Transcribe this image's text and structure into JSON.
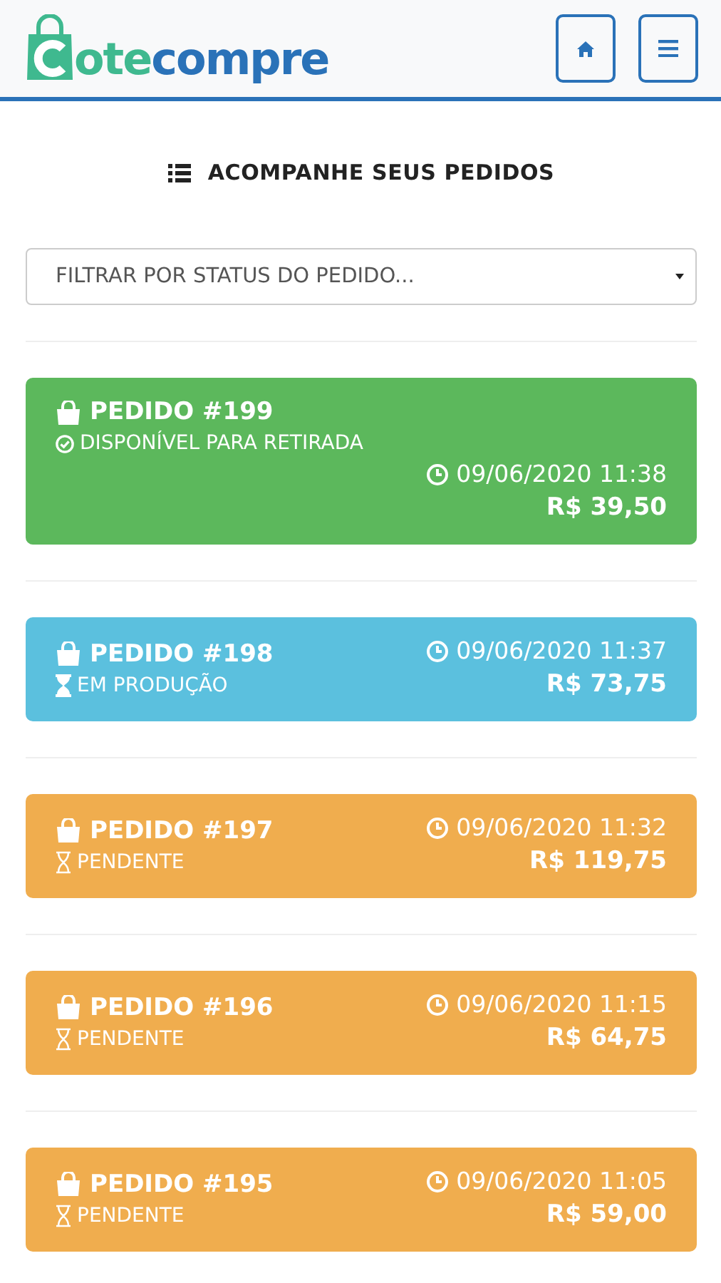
{
  "header": {
    "logo": {
      "part_1": "ote",
      "part_2": "compre"
    },
    "buttons": [
      {
        "kind": "home"
      },
      {
        "kind": "menu"
      }
    ]
  },
  "title": "ACOMPANHE SEUS PEDIDOS",
  "filter": {
    "placeholder": "FILTRAR POR STATUS DO PEDIDO..."
  },
  "orders": [
    {
      "kind": "ready",
      "title": "PEDIDO #199",
      "status": "DISPONÍVEL PARA RETIRADA",
      "date": "09/06/2020 11:38",
      "price": "R$ 39,50",
      "color": "#5cb85c"
    },
    {
      "kind": "production",
      "title": "PEDIDO #198",
      "status": "EM PRODUÇÃO",
      "date": "09/06/2020 11:37",
      "price": "R$ 73,75",
      "color": "#5bc0de"
    },
    {
      "kind": "pending",
      "title": "PEDIDO #197",
      "status": "PENDENTE",
      "date": "09/06/2020 11:32",
      "price": "R$ 119,75",
      "color": "#f0ad4e"
    },
    {
      "kind": "pending",
      "title": "PEDIDO #196",
      "status": "PENDENTE",
      "date": "09/06/2020 11:15",
      "price": "R$ 64,75",
      "color": "#f0ad4e"
    },
    {
      "kind": "pending",
      "title": "PEDIDO #195",
      "status": "PENDENTE",
      "date": "09/06/2020 11:05",
      "price": "R$ 59,00",
      "color": "#f0ad4e"
    }
  ]
}
